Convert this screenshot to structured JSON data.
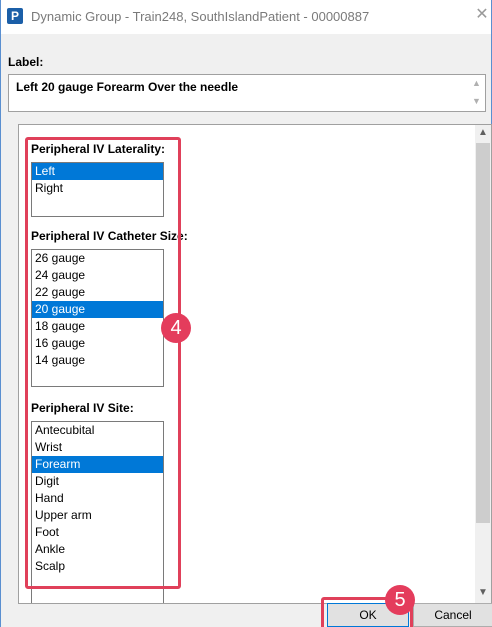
{
  "window": {
    "title": "Dynamic Group -  Train248, SouthIslandPatient - 00000887",
    "app_icon_letter": "P",
    "close_glyph": "✕"
  },
  "label_field": {
    "caption": "Label:",
    "value": "Left 20 gauge Forearm Over the needle"
  },
  "sections": [
    {
      "title": "Peripheral IV Laterality:",
      "items": [
        "Left",
        "Right"
      ],
      "selected": "Left"
    },
    {
      "title": "Peripheral IV Catheter Size:",
      "items": [
        "26 gauge",
        "24 gauge",
        "22 gauge",
        "20 gauge",
        "18 gauge",
        "16 gauge",
        "14 gauge"
      ],
      "selected": "20 gauge"
    },
    {
      "title": "Peripheral IV Site:",
      "items": [
        "Antecubital",
        "Wrist",
        "Forearm",
        "Digit",
        "Hand",
        "Upper arm",
        "Foot",
        "Ankle",
        "Scalp"
      ],
      "selected": "Forearm"
    }
  ],
  "annotations": {
    "badge_4": "4",
    "badge_5": "5",
    "highlight_color": "#e0405a"
  },
  "buttons": {
    "ok": "OK",
    "cancel": "Cancel"
  },
  "colors": {
    "selection": "#0078d7",
    "badge": "#e43c5c"
  }
}
